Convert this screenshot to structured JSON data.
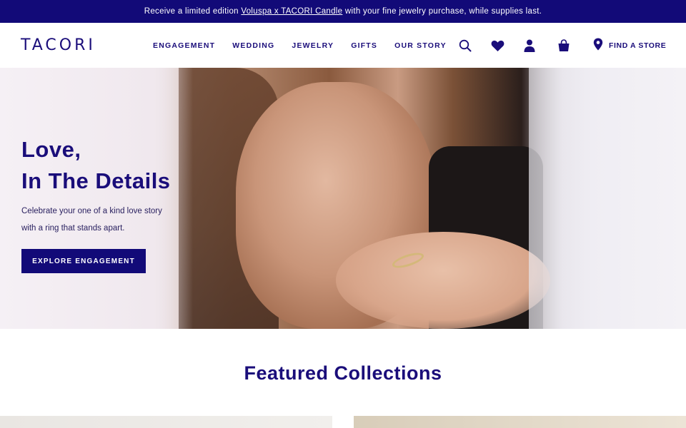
{
  "promo": {
    "prefix": "Receive a limited edition ",
    "link": "Voluspa x TACORI Candle",
    "suffix": " with your fine jewelry purchase, while supplies last."
  },
  "header": {
    "logo": "TACORI",
    "nav": [
      "ENGAGEMENT",
      "WEDDING",
      "JEWELRY",
      "GIFTS",
      "OUR STORY"
    ],
    "icons": [
      "search-icon",
      "heart-icon",
      "user-icon",
      "bag-icon",
      "location-pin-icon"
    ],
    "find_store": "FIND A STORE"
  },
  "hero": {
    "title_line1": "Love,",
    "title_line2": "In The Details",
    "subtitle_line1": "Celebrate your one of a kind love story",
    "subtitle_line2": "with a ring that stands apart.",
    "cta": "EXPLORE ENGAGEMENT"
  },
  "featured": {
    "heading": "Featured Collections"
  },
  "colors": {
    "brand": "#120a78",
    "text": "#1a0d7a",
    "background": "#ffffff"
  }
}
